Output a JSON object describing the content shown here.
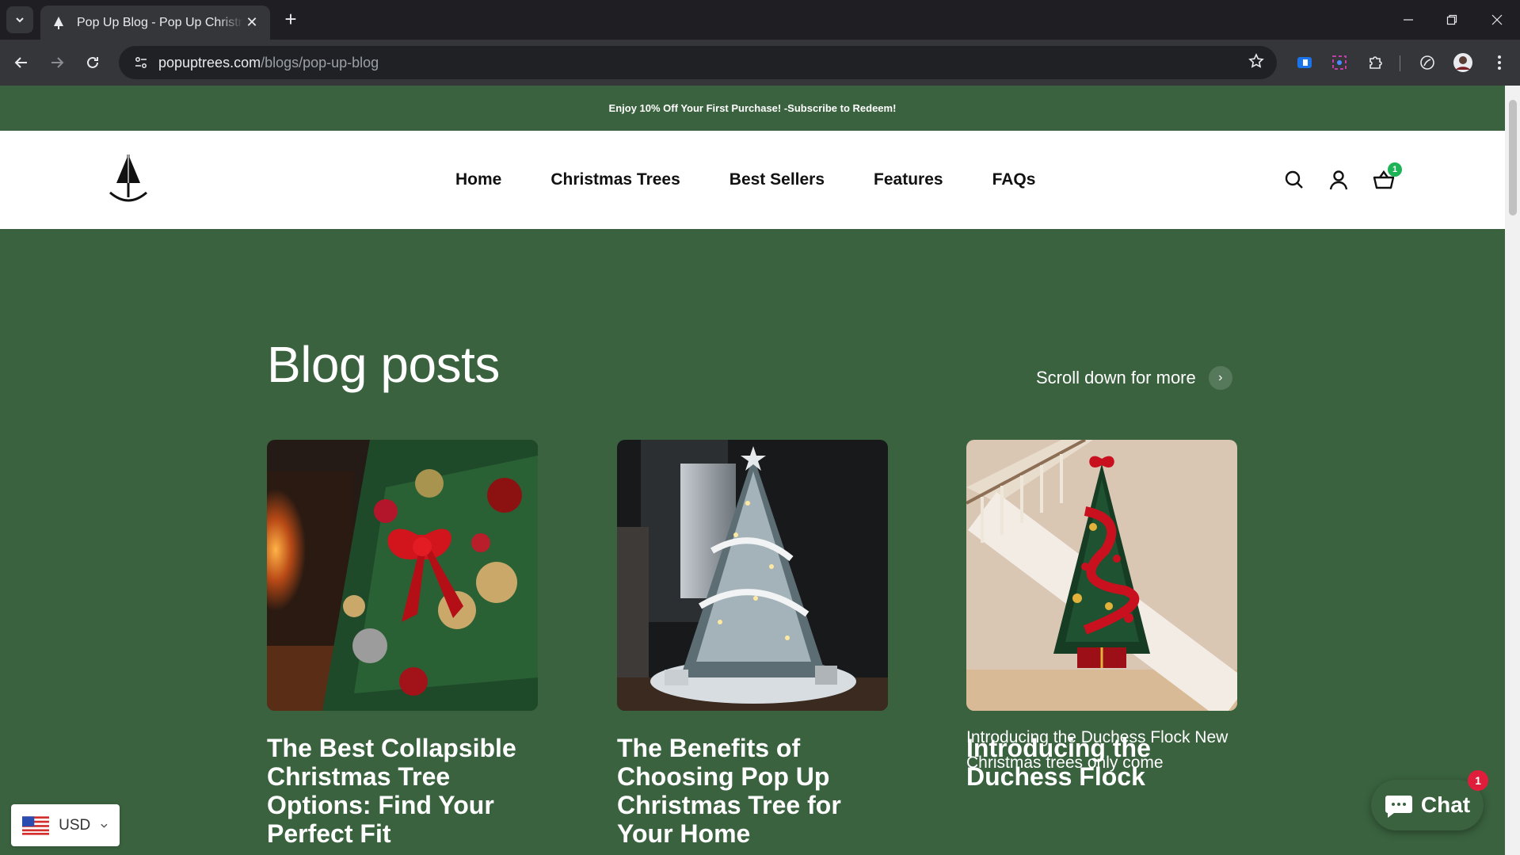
{
  "browser": {
    "tab_title": "Pop Up Blog - Pop Up Christmas Trees",
    "url_host": "popuptrees.com",
    "url_path": "/blogs/pop-up-blog"
  },
  "announcement": "Enjoy 10% Off Your First Purchase! -Subscribe to Redeem!",
  "nav": {
    "items": [
      "Home",
      "Christmas Trees",
      "Best Sellers",
      "Features",
      "FAQs"
    ]
  },
  "cart": {
    "count": "1"
  },
  "blog": {
    "title": "Blog posts",
    "scroll_more": "Scroll down for more",
    "scroll_arrow": "›",
    "posts": [
      {
        "title": "The Best Collapsible Christmas Tree Options: Find Your Perfect Fit",
        "excerpt": ""
      },
      {
        "title": "The Benefits of Choosing Pop Up Christmas Tree for Your Home",
        "excerpt": ""
      },
      {
        "title": "Introducing the Duchess Flock",
        "excerpt": "Introducing the Duchess Flock New Christmas trees only come"
      }
    ]
  },
  "currency": {
    "code": "USD"
  },
  "chat": {
    "label": "Chat",
    "badge": "1"
  },
  "colors": {
    "brand_green": "#3a623f",
    "badge_green": "#1fb357",
    "chat_badge": "#e01e3c"
  }
}
